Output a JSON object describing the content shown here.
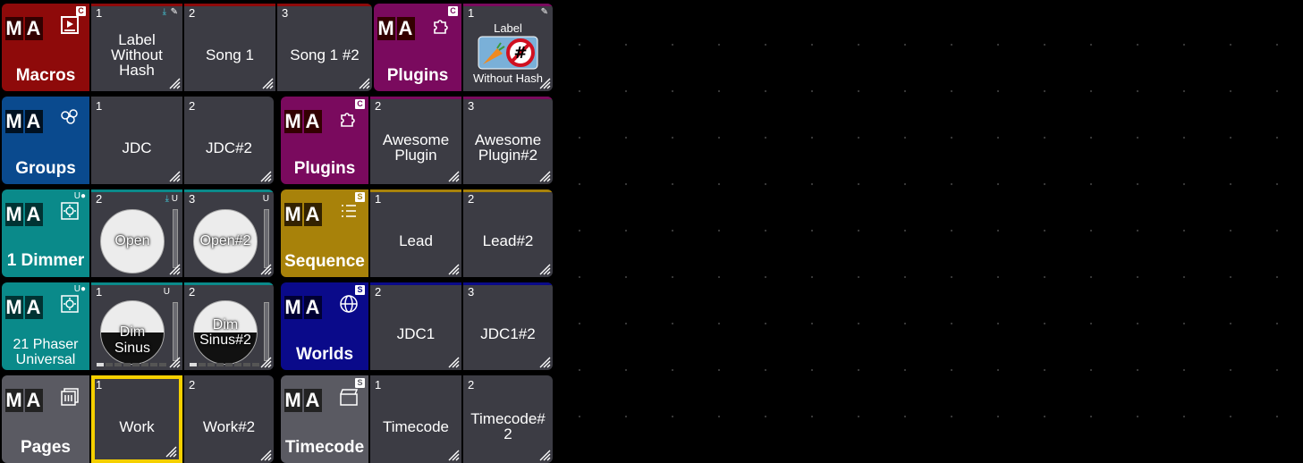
{
  "pools": {
    "macros": {
      "title": "Macros",
      "badge": "C",
      "color": "#8e0a0a",
      "tiles": [
        {
          "num": "1",
          "label": "Label Without Hash"
        },
        {
          "num": "2",
          "label": "Song 1"
        },
        {
          "num": "3",
          "label": "Song 1 #2"
        }
      ]
    },
    "plugins_top": {
      "title": "Plugins",
      "badge": "C",
      "color": "#7a0a5e",
      "tiles": [
        {
          "num": "1",
          "label_top": "Label",
          "label_bottom": "Without Hash"
        }
      ]
    },
    "groups": {
      "title": "Groups",
      "color": "#0a4a8e",
      "tiles": [
        {
          "num": "1",
          "label": "JDC"
        },
        {
          "num": "2",
          "label": "JDC#2"
        }
      ]
    },
    "plugins": {
      "title": "Plugins",
      "badge": "C",
      "color": "#7a0a5e",
      "tiles": [
        {
          "num": "2",
          "label": "Awesome Plugin"
        },
        {
          "num": "3",
          "label": "Awesome Plugin#2"
        }
      ]
    },
    "dimmer": {
      "title": "1 Dimmer",
      "color": "#0a8a8a",
      "tiles": [
        {
          "num": "2",
          "label": "Open",
          "flag": "U"
        },
        {
          "num": "3",
          "label": "Open#2",
          "flag": "U"
        }
      ]
    },
    "sequence": {
      "title": "Sequence",
      "badge": "S",
      "color": "#a8820a",
      "tiles": [
        {
          "num": "1",
          "label": "Lead"
        },
        {
          "num": "2",
          "label": "Lead#2"
        }
      ]
    },
    "phaser": {
      "title": "21 Phaser Universal",
      "color": "#0a8a8a",
      "tiles": [
        {
          "num": "1",
          "label": "Dim Sinus",
          "flag": "U"
        },
        {
          "num": "2",
          "label": "Dim Sinus#2"
        }
      ]
    },
    "worlds": {
      "title": "Worlds",
      "badge": "S",
      "color": "#0a0a8a",
      "tiles": [
        {
          "num": "2",
          "label": "JDC1"
        },
        {
          "num": "3",
          "label": "JDC1#2"
        }
      ]
    },
    "pages": {
      "title": "Pages",
      "color": "#5a5a62",
      "tiles": [
        {
          "num": "1",
          "label": "Work"
        },
        {
          "num": "2",
          "label": "Work#2"
        }
      ]
    },
    "timecode": {
      "title": "Timecode",
      "badge": "S",
      "color": "#5a5a62",
      "tiles": [
        {
          "num": "1",
          "label": "Timecode"
        },
        {
          "num": "2",
          "label": "Timecode# 2"
        }
      ]
    }
  },
  "ma_letters": [
    "M",
    "A"
  ],
  "colors": {
    "selected_border": "#f5d000",
    "tile_bg": "#3c3c44",
    "background": "#000000"
  }
}
